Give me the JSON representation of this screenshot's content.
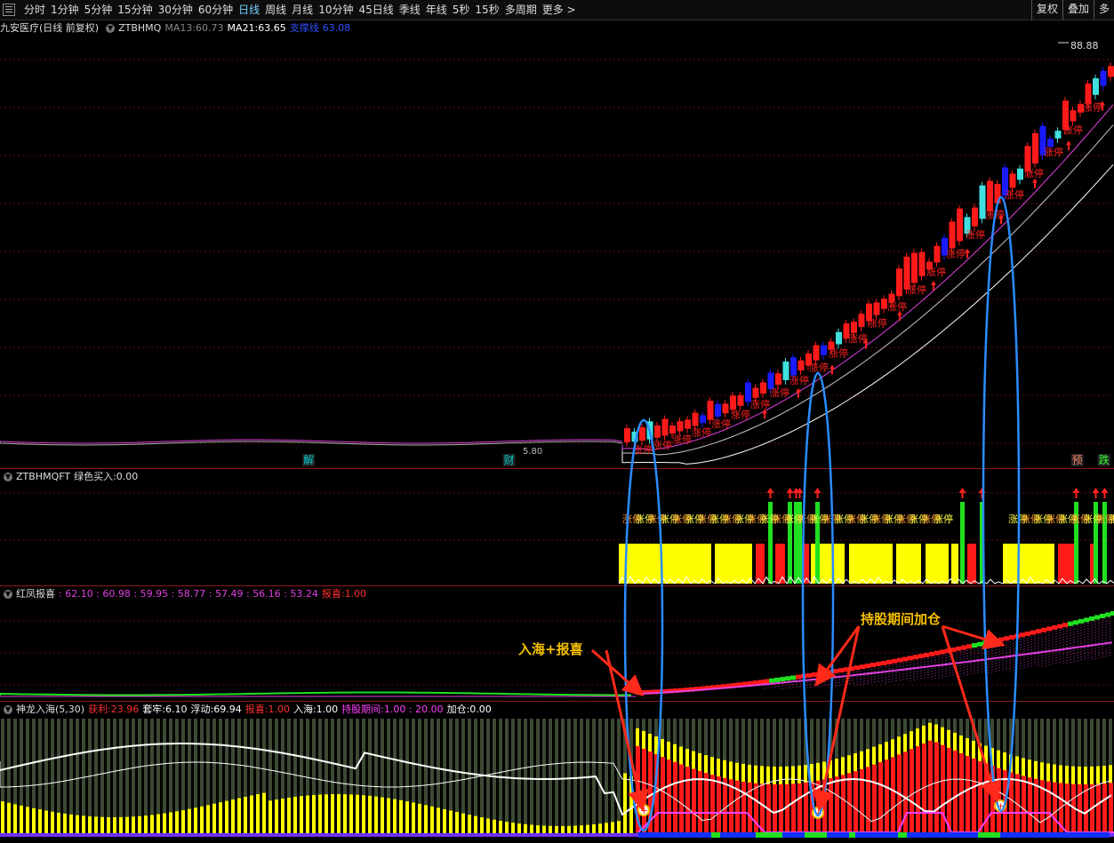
{
  "toolbar": {
    "periods": [
      "分时",
      "1分钟",
      "5分钟",
      "15分钟",
      "30分钟",
      "60分钟",
      "日线",
      "周线",
      "月线",
      "10分钟",
      "45日线",
      "季线",
      "年线",
      "5秒",
      "15秒",
      "多周期",
      "更多 >"
    ],
    "active": "日线",
    "right_buttons": [
      "复权",
      "叠加",
      "多"
    ]
  },
  "main_panel": {
    "stock_title": "九安医疗(日线 前复权)",
    "indicator_name": "ZTBHMQ",
    "ma13_label": "MA13:",
    "ma13_value": "60.73",
    "ma21_label": "MA21:",
    "ma21_value": "63.65",
    "support_label": "支撑线",
    "support_value": "63.08",
    "high_price": "88.88",
    "low_price": "5.80",
    "limit_up_text": "涨停",
    "bottom_markers": [
      {
        "text": "解",
        "color": "#00c8c8",
        "pos": 0.277
      },
      {
        "text": "财",
        "color": "#00c8c8",
        "pos": 0.457
      },
      {
        "text": "预",
        "color": "#f08060",
        "pos": 0.967
      },
      {
        "text": "跌",
        "color": "#30ff30",
        "pos": 0.991
      }
    ]
  },
  "panel2": {
    "indicator_name": "ZTBHMQFT",
    "line_label": "绿色买入:",
    "line_value": "0.00"
  },
  "panel3": {
    "indicator_name": "红凤报喜",
    "values": [
      ": 62.10",
      ": 60.98",
      ": 59.95",
      ": 58.77",
      ": 57.49",
      ": 56.16",
      ": 53.24"
    ],
    "baoxi_label": "报喜:",
    "baoxi_value": "1.00"
  },
  "panel4": {
    "indicator_name": "神龙入海(5,30)",
    "items": [
      {
        "label": "获利:",
        "value": "23.96",
        "color": "#ff3030"
      },
      {
        "label": "套牢:",
        "value": "6.10",
        "color": "#ffffff"
      },
      {
        "label": "浮动:",
        "value": "69.94",
        "color": "#ffffff"
      },
      {
        "label": "报喜:",
        "value": "1.00",
        "color": "#ff3030"
      },
      {
        "label": "入海:",
        "value": "1.00",
        "color": "#ffffff"
      },
      {
        "label": "持股期间:",
        "value": "1.00 : 20.00",
        "color": "#ff40ff"
      },
      {
        "label": "加仓:",
        "value": "0.00",
        "color": "#ffffff"
      }
    ]
  },
  "annotations": {
    "enter": "入海+报喜",
    "add": "持股期间加仓"
  },
  "colors": {
    "up": "#ff1a1a",
    "down": "#1a1aff",
    "yellow": "#ffff00",
    "green": "#20e020",
    "magenta": "#e040e0",
    "ellipse": "#2a8cff"
  }
}
